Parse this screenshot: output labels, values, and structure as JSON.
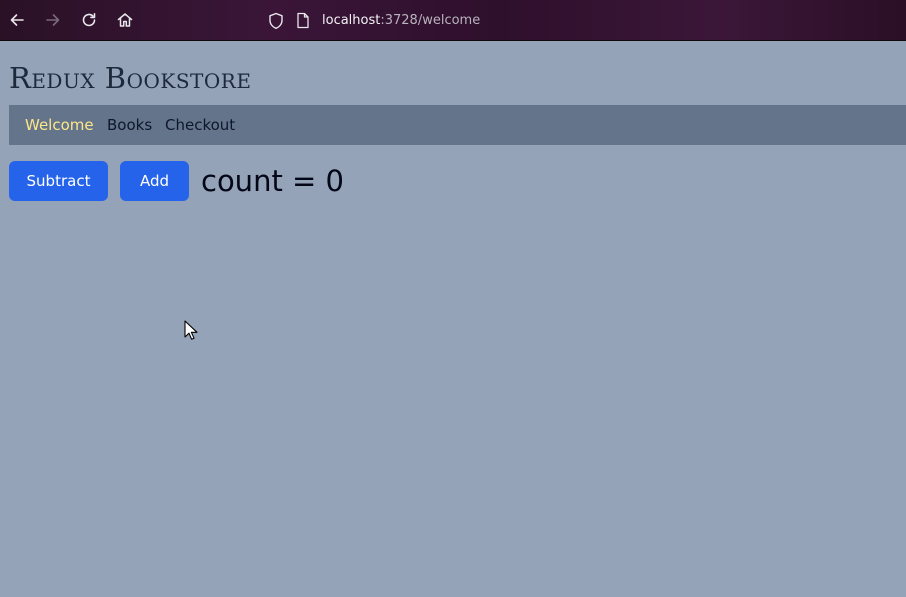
{
  "browser": {
    "url_host": "localhost",
    "url_rest": ":3728/welcome",
    "icons": [
      "back-arrow-icon",
      "forward-arrow-icon",
      "reload-icon",
      "home-icon",
      "shield-icon",
      "page-icon"
    ]
  },
  "page": {
    "title": "Redux Bookstore",
    "nav": [
      {
        "label": "Welcome",
        "active": true
      },
      {
        "label": "Books",
        "active": false
      },
      {
        "label": "Checkout",
        "active": false
      }
    ],
    "subtract_label": "Subtract",
    "add_label": "Add",
    "count_text": "count = 0"
  },
  "colors": {
    "page_bg": "#94a3b8",
    "nav_bg": "#64748b",
    "nav_active": "#fde68a",
    "button_bg": "#2563eb",
    "title": "#1e293b"
  }
}
